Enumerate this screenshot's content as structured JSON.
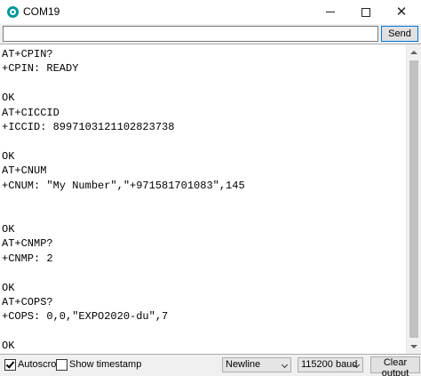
{
  "window": {
    "title": "COM19",
    "minimize_icon": "minimize-icon",
    "maximize_icon": "maximize-icon",
    "close_icon": "close-icon",
    "close_glyph": "✕"
  },
  "input": {
    "value": "",
    "placeholder": "",
    "send_label": "Send"
  },
  "output": {
    "lines": [
      "AT+CPIN?",
      "+CPIN: READY",
      "",
      "OK",
      "AT+CICCID",
      "+ICCID: 8997103121102823738",
      "",
      "OK",
      "AT+CNUM",
      "+CNUM: \"My Number\",\"+971581701083\",145",
      "",
      "",
      "OK",
      "AT+CNMP?",
      "+CNMP: 2",
      "",
      "OK",
      "AT+COPS?",
      "+COPS: 0,0,\"EXPO2020-du\",7",
      "",
      "OK"
    ]
  },
  "status": {
    "autoscroll_label": "Autoscroll",
    "autoscroll_checked": true,
    "timestamp_label": "Show timestamp",
    "timestamp_checked": false,
    "line_ending": "Newline",
    "baud": "115200 baud",
    "clear_label": "Clear output"
  },
  "colors": {
    "accent": "#00979c",
    "focus_border": "#0078d7"
  }
}
